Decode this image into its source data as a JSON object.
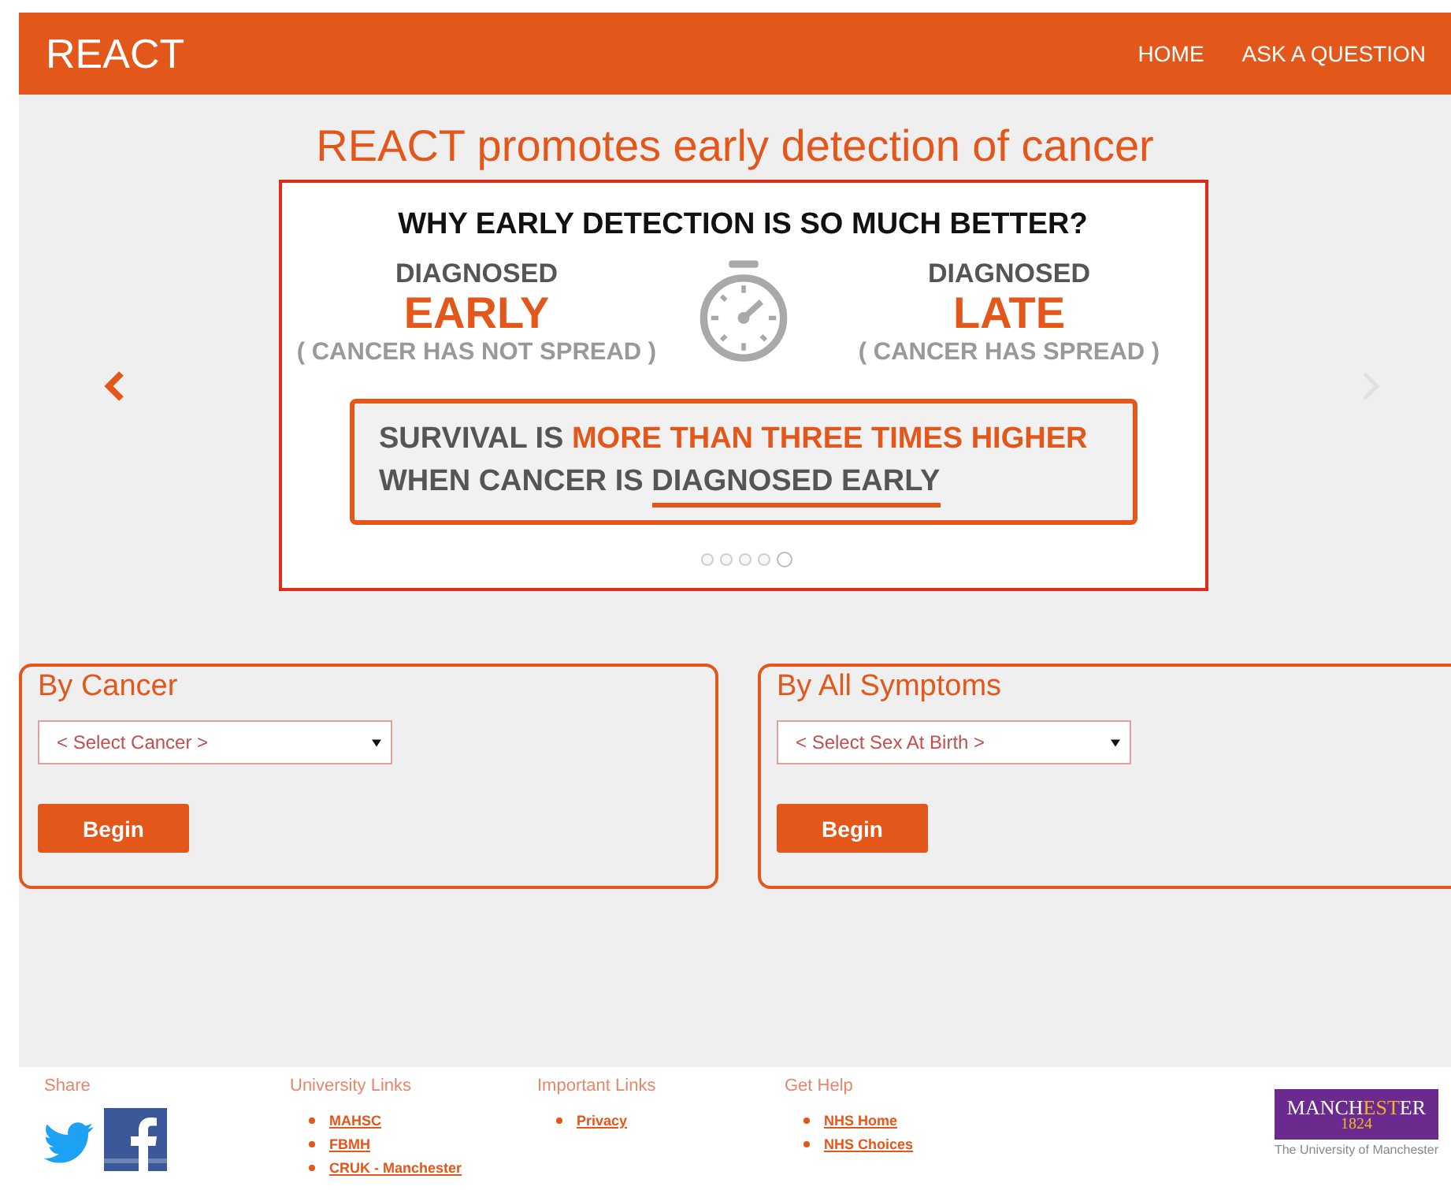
{
  "header": {
    "logo": "REACT",
    "nav": [
      {
        "label": "HOME"
      },
      {
        "label": "ASK A QUESTION"
      }
    ]
  },
  "page_title": "REACT promotes early detection of cancer",
  "carousel": {
    "slide": {
      "headline": "WHY EARLY DETECTION IS SO MUCH BETTER?",
      "columns": [
        {
          "label": "DIAGNOSED",
          "emphasis": "EARLY",
          "note": "( CANCER HAS NOT SPREAD )"
        },
        {
          "label": "DIAGNOSED",
          "emphasis": "LATE",
          "note": "( CANCER HAS SPREAD )"
        }
      ],
      "callout": [
        "SURVIVAL IS **MORE THAN THREE TIMES HIGHER**",
        "WHEN CANCER IS *DIAGNOSED EARLY*"
      ]
    },
    "indicators": [
      {
        "selected": false
      },
      {
        "selected": false
      },
      {
        "selected": false
      },
      {
        "selected": false
      },
      {
        "selected": true
      }
    ]
  },
  "panels": [
    {
      "title": "By Cancer",
      "select": {
        "placeholder": "< Select Cancer >"
      },
      "button": "Begin"
    },
    {
      "title": "By All Symptoms",
      "select": {
        "placeholder": "< Select Sex At Birth >"
      },
      "button": "Begin"
    }
  ],
  "footer": {
    "share": {
      "title": "Share"
    },
    "columns": [
      {
        "title": "University Links",
        "links": [
          "MAHSC",
          "FBMH",
          "CRUK - Manchester"
        ]
      },
      {
        "title": "Important Links",
        "links": [
          "Privacy"
        ]
      },
      {
        "title": "Get Help",
        "links": [
          "NHS Home",
          "NHS Choices"
        ]
      }
    ],
    "logo": {
      "word_start": "MANCH",
      "word_mid": "EST",
      "word_end": "ER",
      "year": "1824",
      "caption": "The University of Manchester"
    }
  }
}
